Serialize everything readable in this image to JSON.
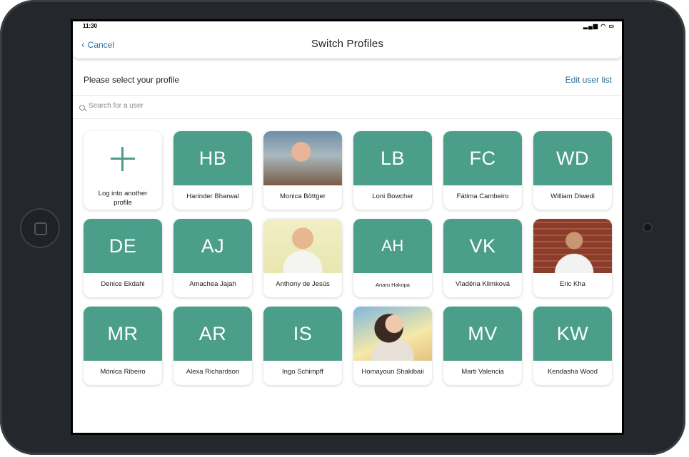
{
  "statusbar": {
    "time": "11:30",
    "indicators": "▂▄▆ ◠ ▭"
  },
  "navbar": {
    "cancel_label": "Cancel",
    "title": "Switch Profiles"
  },
  "select": {
    "label": "Please select your profile",
    "edit_label": "Edit user list"
  },
  "search": {
    "placeholder": "Search for a user"
  },
  "add_profile": {
    "label": "Log into another profile"
  },
  "accent_color": "#4a9e8a",
  "link_color": "#2d6f9b",
  "profiles": [
    {
      "initials": "HB",
      "name": "Harinder Bharwal",
      "photo": false
    },
    {
      "initials": "",
      "name": "Monica Böttger",
      "photo": true
    },
    {
      "initials": "LB",
      "name": "Loni Bowcher",
      "photo": false
    },
    {
      "initials": "FC",
      "name": "Fátima Cambeiro",
      "photo": false
    },
    {
      "initials": "WD",
      "name": "William Diwedi",
      "photo": false
    },
    {
      "initials": "DE",
      "name": "Denice Ekdahl",
      "photo": false
    },
    {
      "initials": "AJ",
      "name": "Amachea Jajah",
      "photo": false
    },
    {
      "initials": "",
      "name": "Anthony de Jesús",
      "photo": true
    },
    {
      "initials": "AH",
      "name": "Anaru Hakopa",
      "photo": false
    },
    {
      "initials": "VK",
      "name": "Vladěna Klimková",
      "photo": false
    },
    {
      "initials": "",
      "name": "Eric Kha",
      "photo": true
    },
    {
      "initials": "MR",
      "name": "Mónica Ribeiro",
      "photo": false
    },
    {
      "initials": "AR",
      "name": "Alexa Richardson",
      "photo": false
    },
    {
      "initials": "IS",
      "name": "Ingo Schimpff",
      "photo": false
    },
    {
      "initials": "",
      "name": "Homayoun Shakibaii",
      "photo": true
    },
    {
      "initials": "MV",
      "name": "Marti Valencia",
      "photo": false
    },
    {
      "initials": "KW",
      "name": "Kendasha Wood",
      "photo": false
    }
  ]
}
